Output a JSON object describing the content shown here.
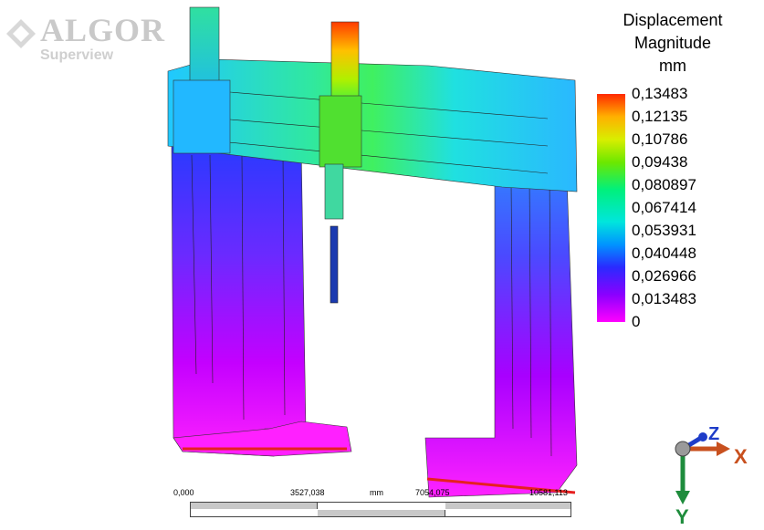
{
  "logo": {
    "brand": "ALGOR",
    "product": "Superview"
  },
  "legend": {
    "title_line1": "Displacement",
    "title_line2": "Magnitude",
    "unit": "mm",
    "ticks": [
      "0,13483",
      "0,12135",
      "0,10786",
      "0,09438",
      "0,080897",
      "0,067414",
      "0,053931",
      "0,040448",
      "0,026966",
      "0,013483",
      "0"
    ]
  },
  "scale": {
    "labels": [
      "0,000",
      "3527,038",
      "mm",
      "7054,075",
      "10581,113"
    ]
  },
  "triad": {
    "x": "X",
    "y": "Y",
    "z": "Z"
  },
  "colors": {
    "max": "#ff2a00",
    "min": "#ff00ff",
    "axis_x": "#c8501e",
    "axis_y": "#1e8c3c",
    "axis_z": "#1e3cc8"
  }
}
